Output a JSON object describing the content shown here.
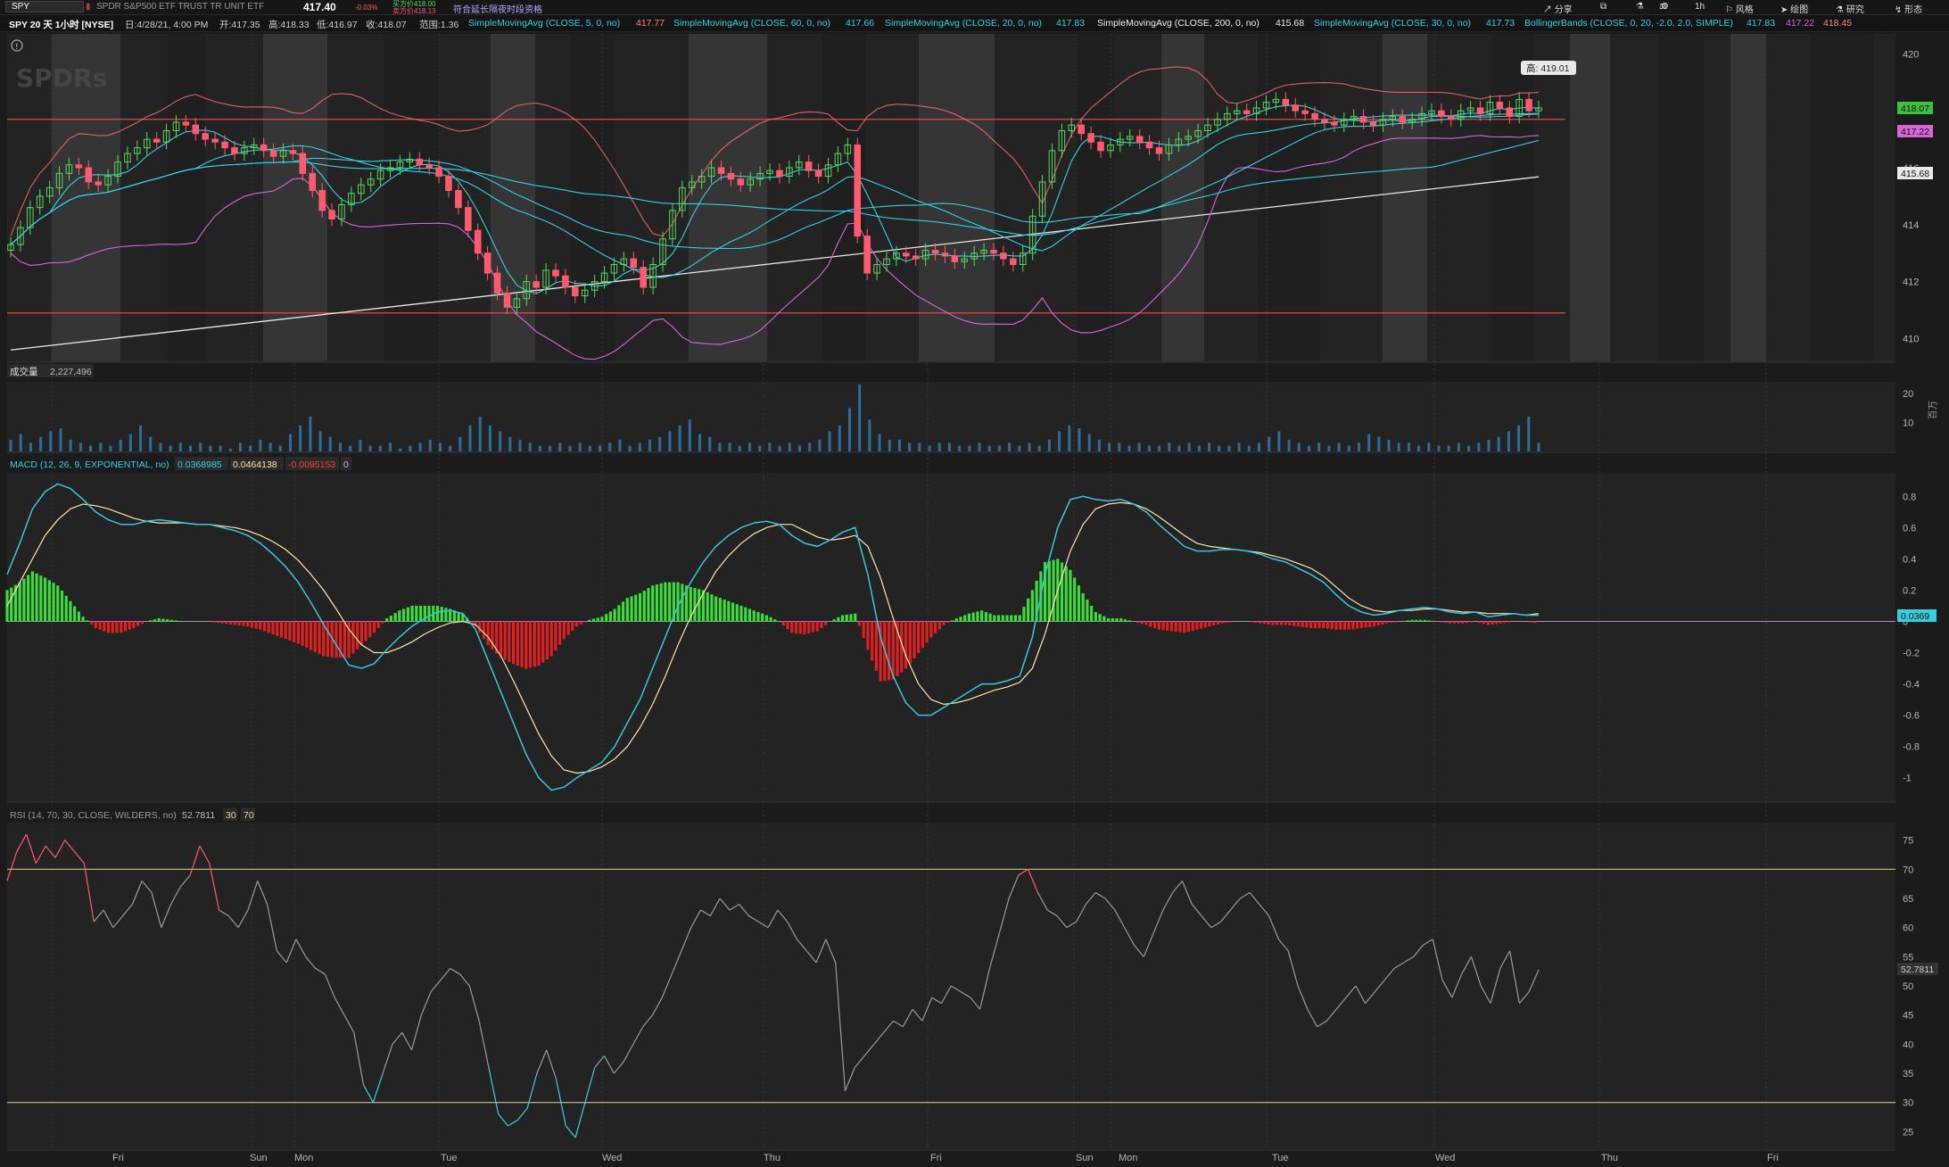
{
  "topbar": {
    "symbol": "SPY",
    "description": "SPDR S&P500 ETF TRUST TR UNIT ETF",
    "last_price": "417.40",
    "change": "-0.03%",
    "bid": "买方价418.00",
    "ask": "卖方价418.13",
    "extended_link": "符合延长隔夜时段资格",
    "share": "分享",
    "timeframe": "1h",
    "style": "风格",
    "drawing": "绘图",
    "research": "研究",
    "pattern": "形态"
  },
  "infobar": {
    "title": "SPY 20 天 1小时 [NYSE]",
    "date": "日:4/28/21, 4:00 PM",
    "open": "开:417.35",
    "high": "高:418.33",
    "low": "低:416.97",
    "close": "收:418.07",
    "range": "范围:1.36",
    "sma5": "SimpleMovingAvg (CLOSE, 5, 0, no)",
    "sma5_val": "417.77",
    "sma60": "SimpleMovingAvg (CLOSE, 60, 0, no)",
    "sma60_val": "417.66",
    "sma20": "SimpleMovingAvg (CLOSE, 20, 0, no)",
    "sma20_val": "417.83",
    "sma200": "SimpleMovingAvg (CLOSE, 200, 0, no)",
    "sma200_val": "415.68",
    "sma30": "SimpleMovingAvg (CLOSE, 30, 0, no)",
    "sma30_val": "417.73",
    "bb": "BollingerBands (CLOSE, 0, 20, -2.0, 2.0, SIMPLE)",
    "bb_mid": "417.83",
    "bb_low": "417.22",
    "bb_up": "418.45"
  },
  "watermark": "SPDRs",
  "colors": {
    "up": "#5bd65b",
    "down": "#ff5a6e",
    "sma5": "#ff6b6b",
    "cyan": "#35d0e0",
    "bb": "#d966d9",
    "sma200": "#e8e8e8",
    "band_red": "#e04a4a",
    "macd": "#39c6e0",
    "signal": "#ffe6a8",
    "rsi": "#9a9a9a",
    "rsi_ob": "#ff5a6e",
    "rsi_os": "#35d0e0",
    "level": "#e6d78c"
  },
  "chart_data": [
    {
      "type": "candlestick",
      "panel": "price",
      "title": "SPY 20 天 1小时 [NYSE]",
      "ylim": [
        409.2,
        420.7
      ],
      "yticks": [
        410,
        412,
        414,
        416,
        418,
        420
      ],
      "x_day_labels": [
        "Fri",
        "Sun",
        "Mon",
        "Tue",
        "Wed",
        "Thu",
        "Fri",
        "Sun",
        "Mon",
        "Tue",
        "Wed",
        "Thu",
        "Fri"
      ],
      "high_annotation": "高: 419.01",
      "price_tags": [
        {
          "value": "418.07",
          "color": "#3fbf3f"
        },
        {
          "value": "417.22",
          "color": "#d966d9"
        },
        {
          "value": "415.68",
          "color": "#e8e8e8"
        }
      ],
      "support_resistance": [
        417.7,
        410.9
      ],
      "closes": [
        413.3,
        413.9,
        414.6,
        415.0,
        415.3,
        415.8,
        416.1,
        416.0,
        415.5,
        415.4,
        415.7,
        416.2,
        416.5,
        416.7,
        417.0,
        416.9,
        417.3,
        417.6,
        417.5,
        417.2,
        417.0,
        416.9,
        416.7,
        416.5,
        416.7,
        416.8,
        416.6,
        416.4,
        416.6,
        416.5,
        415.8,
        415.2,
        414.5,
        414.2,
        414.7,
        415.1,
        415.4,
        415.6,
        415.9,
        416.0,
        416.2,
        416.3,
        416.1,
        416.0,
        415.7,
        415.2,
        414.6,
        413.8,
        413.0,
        412.3,
        411.6,
        411.1,
        411.4,
        412.0,
        411.8,
        412.4,
        412.2,
        411.8,
        411.5,
        411.7,
        412.0,
        412.3,
        412.6,
        412.8,
        412.5,
        411.8,
        412.6,
        413.5,
        414.5,
        415.3,
        415.5,
        415.7,
        416.0,
        415.8,
        415.6,
        415.4,
        415.6,
        415.8,
        415.9,
        415.7,
        416.0,
        416.2,
        415.9,
        415.7,
        416.1,
        416.5,
        416.8,
        413.6,
        412.3,
        412.6,
        412.8,
        413.0,
        412.9,
        412.8,
        413.1,
        413.0,
        412.9,
        412.7,
        412.8,
        413.0,
        413.1,
        413.0,
        412.8,
        412.6,
        413.0,
        414.3,
        415.5,
        416.6,
        417.3,
        417.5,
        417.2,
        416.9,
        416.6,
        416.8,
        417.0,
        417.1,
        416.9,
        416.7,
        416.5,
        416.8,
        417.0,
        417.1,
        417.3,
        417.5,
        417.7,
        417.9,
        418.0,
        417.9,
        418.1,
        418.3,
        418.4,
        418.2,
        418.0,
        417.9,
        417.7,
        417.6,
        417.5,
        417.7,
        417.8,
        417.6,
        417.5,
        417.7,
        417.8,
        417.6,
        417.7,
        417.9,
        418.0,
        417.8,
        417.7,
        418.0,
        418.1,
        417.9,
        418.3,
        418.1,
        417.8,
        418.4,
        418.0,
        418.1
      ],
      "sma200_start": 409.6,
      "sma200_end": 415.68
    },
    {
      "type": "bar",
      "panel": "volume",
      "title": "成交量",
      "current": "2,227,496",
      "unit_label": "百万",
      "ylim": [
        0,
        24
      ],
      "yticks": [
        10,
        20
      ],
      "values": [
        4,
        6,
        3,
        5,
        7,
        8,
        4,
        3,
        2,
        3,
        2,
        4,
        6,
        9,
        5,
        3,
        2,
        3,
        2,
        3,
        2,
        2,
        1,
        3,
        2,
        4,
        3,
        2,
        6,
        9,
        12,
        7,
        5,
        3,
        2,
        4,
        2,
        2,
        3,
        1,
        2,
        3,
        4,
        3,
        2,
        5,
        9,
        12,
        9,
        7,
        5,
        4,
        3,
        2,
        2,
        3,
        2,
        3,
        2,
        2,
        3,
        4,
        2,
        3,
        4,
        5,
        7,
        9,
        11,
        6,
        5,
        3,
        3,
        2,
        3,
        2,
        3,
        2,
        3,
        2,
        3,
        4,
        7,
        9,
        15,
        23,
        11,
        6,
        4,
        4,
        3,
        3,
        2,
        3,
        3,
        2,
        2,
        3,
        2,
        2,
        3,
        2,
        3,
        2,
        4,
        7,
        9,
        8,
        6,
        4,
        3,
        3,
        2,
        3,
        2,
        2,
        3,
        2,
        3,
        2,
        3,
        2,
        2,
        3,
        2,
        3,
        5,
        7,
        4,
        3,
        2,
        3,
        2,
        3,
        2,
        3,
        6,
        5,
        4,
        3,
        3,
        2,
        3,
        2,
        2,
        3,
        2,
        3,
        4,
        5,
        7,
        9,
        12,
        3
      ],
      "color": "#2d6d9a"
    },
    {
      "type": "line",
      "panel": "macd",
      "title": "MACD (12, 26, 9, EXPONENTIAL, no)",
      "values_shown": [
        "0.0368985",
        "0.0464138",
        "-0.0095153",
        "0"
      ],
      "ylim": [
        -1.15,
        0.95
      ],
      "yticks": [
        0.8,
        0.6,
        0.4,
        0.2,
        0,
        -0.2,
        -0.4,
        -0.6,
        -0.8,
        -1
      ],
      "price_tag": "0.0369",
      "series": [
        {
          "name": "Value",
          "values": [
            0.3,
            0.5,
            0.72,
            0.83,
            0.88,
            0.85,
            0.78,
            0.7,
            0.65,
            0.62,
            0.62,
            0.64,
            0.65,
            0.64,
            0.63,
            0.62,
            0.62,
            0.6,
            0.58,
            0.55,
            0.5,
            0.43,
            0.35,
            0.25,
            0.12,
            -0.02,
            -0.15,
            -0.28,
            -0.3,
            -0.27,
            -0.18,
            -0.1,
            -0.03,
            0.02,
            0.06,
            0.07,
            0.05,
            -0.05,
            -0.25,
            -0.45,
            -0.65,
            -0.85,
            -1.0,
            -1.08,
            -1.06,
            -1.0,
            -0.95,
            -0.9,
            -0.8,
            -0.65,
            -0.5,
            -0.3,
            -0.1,
            0.1,
            0.25,
            0.38,
            0.48,
            0.55,
            0.6,
            0.63,
            0.64,
            0.62,
            0.55,
            0.5,
            0.48,
            0.52,
            0.57,
            0.6,
            0.3,
            -0.1,
            -0.35,
            -0.52,
            -0.6,
            -0.6,
            -0.55,
            -0.5,
            -0.45,
            -0.4,
            -0.4,
            -0.38,
            -0.35,
            -0.1,
            0.3,
            0.6,
            0.78,
            0.8,
            0.78,
            0.77,
            0.78,
            0.75,
            0.7,
            0.62,
            0.55,
            0.48,
            0.45,
            0.45,
            0.46,
            0.46,
            0.45,
            0.43,
            0.4,
            0.38,
            0.34,
            0.3,
            0.25,
            0.17,
            0.1,
            0.06,
            0.04,
            0.05,
            0.07,
            0.08,
            0.09,
            0.08,
            0.06,
            0.05,
            0.06,
            0.03,
            0.04,
            0.05,
            0.04,
            0.04
          ]
        },
        {
          "name": "Avg",
          "values": [
            0.1,
            0.25,
            0.4,
            0.55,
            0.65,
            0.72,
            0.75,
            0.74,
            0.72,
            0.69,
            0.66,
            0.64,
            0.63,
            0.63,
            0.63,
            0.62,
            0.62,
            0.61,
            0.6,
            0.58,
            0.55,
            0.51,
            0.46,
            0.39,
            0.3,
            0.2,
            0.08,
            -0.05,
            -0.15,
            -0.2,
            -0.2,
            -0.17,
            -0.13,
            -0.08,
            -0.04,
            -0.01,
            0.0,
            -0.02,
            -0.1,
            -0.22,
            -0.38,
            -0.55,
            -0.72,
            -0.86,
            -0.95,
            -0.97,
            -0.96,
            -0.93,
            -0.88,
            -0.8,
            -0.68,
            -0.53,
            -0.35,
            -0.15,
            0.03,
            0.18,
            0.32,
            0.42,
            0.5,
            0.56,
            0.6,
            0.62,
            0.62,
            0.58,
            0.54,
            0.52,
            0.53,
            0.55,
            0.48,
            0.28,
            0.02,
            -0.22,
            -0.4,
            -0.5,
            -0.53,
            -0.52,
            -0.5,
            -0.47,
            -0.44,
            -0.42,
            -0.39,
            -0.3,
            -0.08,
            0.2,
            0.45,
            0.62,
            0.72,
            0.75,
            0.76,
            0.75,
            0.72,
            0.67,
            0.61,
            0.55,
            0.5,
            0.48,
            0.47,
            0.46,
            0.45,
            0.44,
            0.42,
            0.4,
            0.37,
            0.34,
            0.29,
            0.22,
            0.15,
            0.1,
            0.07,
            0.06,
            0.07,
            0.07,
            0.08,
            0.08,
            0.07,
            0.06,
            0.06,
            0.05,
            0.05,
            0.05,
            0.04,
            0.05
          ]
        }
      ]
    },
    {
      "type": "line",
      "panel": "rsi",
      "title": "RSI (14, 70, 30, CLOSE, WILDERS, no)",
      "values_shown": [
        "52.7811",
        "30",
        "70"
      ],
      "ylim": [
        22,
        78
      ],
      "yticks": [
        75,
        70,
        65,
        60,
        55,
        50,
        45,
        40,
        35,
        30,
        25
      ],
      "levels": [
        70,
        30
      ],
      "price_tag": "52.7811",
      "values": [
        68,
        73,
        76,
        71,
        74,
        72,
        75,
        73,
        71,
        61,
        63,
        60,
        62,
        64,
        68,
        66,
        60,
        64,
        67,
        69,
        74,
        71,
        63,
        62,
        60,
        63,
        68,
        64,
        56,
        54,
        58,
        55,
        53,
        52,
        48,
        45,
        42,
        33,
        30,
        35,
        40,
        42,
        39,
        45,
        49,
        51,
        53,
        52,
        50,
        44,
        36,
        28,
        26,
        27,
        29,
        35,
        39,
        34,
        26,
        24,
        30,
        36,
        38,
        35,
        37,
        40,
        43,
        45,
        48,
        52,
        56,
        60,
        63,
        62,
        65,
        63,
        64,
        62,
        61,
        60,
        63,
        61,
        58,
        56,
        54,
        58,
        54,
        32,
        36,
        38,
        40,
        42,
        44,
        43,
        46,
        44,
        48,
        47,
        50,
        49,
        48,
        46,
        53,
        59,
        65,
        69,
        70,
        66,
        63,
        62,
        60,
        61,
        64,
        66,
        65,
        63,
        60,
        57,
        55,
        59,
        63,
        66,
        68,
        64,
        62,
        60,
        61,
        63,
        65,
        66,
        64,
        62,
        58,
        56,
        50,
        46,
        43,
        44,
        46,
        48,
        50,
        47,
        49,
        51,
        53,
        54,
        55,
        57,
        58,
        51,
        48,
        52,
        55,
        50,
        47,
        53,
        56,
        47,
        49,
        52.78
      ]
    }
  ]
}
